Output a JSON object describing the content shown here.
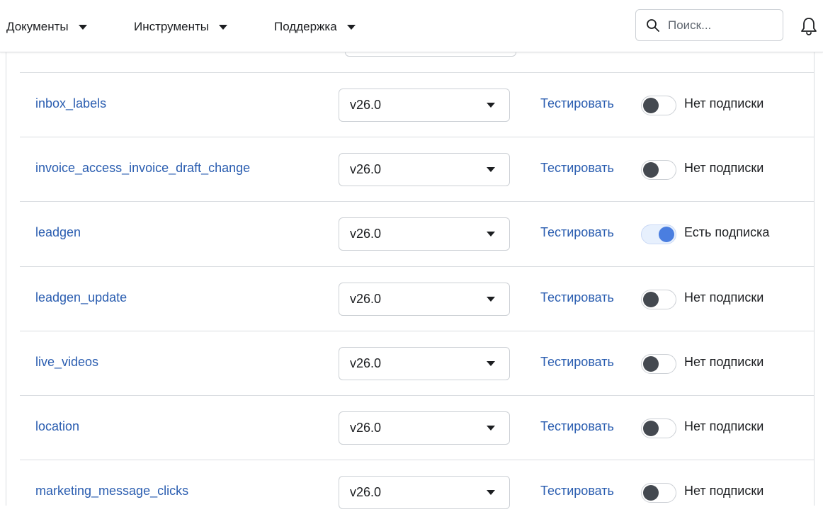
{
  "nav": {
    "documents": "Документы",
    "tools": "Инструменты",
    "support": "Поддержка"
  },
  "search": {
    "placeholder": "Поиск..."
  },
  "colors": {
    "link": "#2a5db0",
    "toggle_on": "#4a7ee0",
    "toggle_off_knob": "#444950"
  },
  "rows": [
    {
      "name": "inbox_labels",
      "version": "v26.0",
      "test_label": "Тестировать",
      "subscribed": false,
      "status": "Нет подписки"
    },
    {
      "name": "invoice_access_invoice_draft_change",
      "version": "v26.0",
      "test_label": "Тестировать",
      "subscribed": false,
      "status": "Нет подписки"
    },
    {
      "name": "leadgen",
      "version": "v26.0",
      "test_label": "Тестировать",
      "subscribed": true,
      "status": "Есть подписка"
    },
    {
      "name": "leadgen_update",
      "version": "v26.0",
      "test_label": "Тестировать",
      "subscribed": false,
      "status": "Нет подписки"
    },
    {
      "name": "live_videos",
      "version": "v26.0",
      "test_label": "Тестировать",
      "subscribed": false,
      "status": "Нет подписки"
    },
    {
      "name": "location",
      "version": "v26.0",
      "test_label": "Тестировать",
      "subscribed": false,
      "status": "Нет подписки"
    },
    {
      "name": "marketing_message_clicks",
      "version": "v26.0",
      "test_label": "Тестировать",
      "subscribed": false,
      "status": "Нет подписки"
    }
  ]
}
